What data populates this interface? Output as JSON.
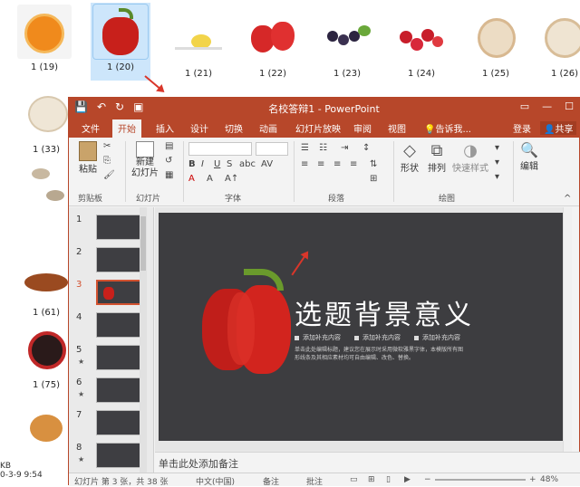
{
  "explorer": {
    "thumbs": [
      {
        "label": "1 (19)"
      },
      {
        "label": "1 (20)"
      },
      {
        "label": "1 (21)"
      },
      {
        "label": "1 (22)"
      },
      {
        "label": "1 (23)"
      },
      {
        "label": "1 (24)"
      },
      {
        "label": "1 (25)"
      },
      {
        "label": "1 (26)"
      },
      {
        "label": "1 (33)"
      },
      {
        "label": "1 (61)"
      },
      {
        "label": "1 (75)"
      }
    ],
    "status_size": "KB",
    "status_date": "0-3-9 9:54"
  },
  "ppt": {
    "title": "名校答辩1 - PowerPoint",
    "tabs": [
      "文件",
      "开始",
      "插入",
      "设计",
      "切换",
      "动画",
      "幻灯片放映",
      "审阅",
      "视图",
      "告诉我..."
    ],
    "active_tab": "开始",
    "login": "登录",
    "share": "共享",
    "ribbon": {
      "paste": "粘贴",
      "clipboard": "剪贴板",
      "new_slide": "新建\n幻灯片",
      "slides": "幻灯片",
      "font": "字体",
      "paragraph": "段落",
      "shape": "形状",
      "arrange": "排列",
      "quick_style": "快速样式",
      "drawing": "绘图",
      "edit": "编辑"
    },
    "slide_nums": [
      "1",
      "2",
      "3",
      "4",
      "5",
      "6",
      "7",
      "8"
    ],
    "star": "★",
    "slide": {
      "title": "选题背景意义",
      "bullets": [
        "添加补充内容",
        "添加补充内容",
        "添加补充内容"
      ],
      "desc": "单击此处编辑标题，建议您在展示时采用微软雅黑字体，本模版所有图形线条及其相应素材均可自由编辑、改色、替换。"
    },
    "notes": "单击此处添加备注",
    "status": {
      "slide_info": "幻灯片 第 3 张，共 38 张",
      "lang": "中文(中国)",
      "notes_btn": "备注",
      "comments_btn": "批注",
      "zoom": "48%"
    }
  }
}
